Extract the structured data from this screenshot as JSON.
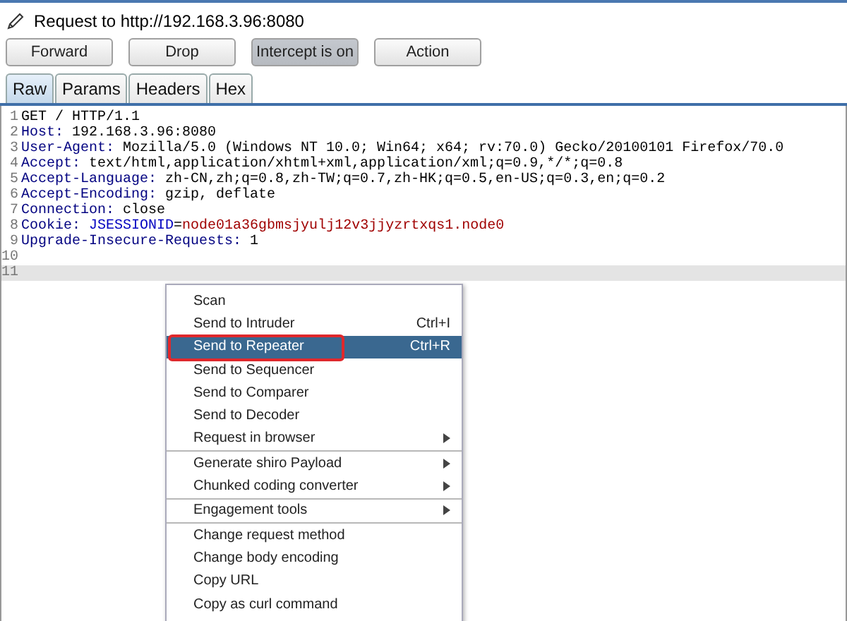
{
  "header": {
    "title": "Request to http://192.168.3.96:8080"
  },
  "buttons": [
    {
      "label": "Forward",
      "pressed": false
    },
    {
      "label": "Drop",
      "pressed": false
    },
    {
      "label": "Intercept is on",
      "pressed": true
    },
    {
      "label": "Action",
      "pressed": false
    }
  ],
  "tabs": [
    {
      "label": "Raw",
      "selected": true
    },
    {
      "label": "Params",
      "selected": false
    },
    {
      "label": "Headers",
      "selected": false
    },
    {
      "label": "Hex",
      "selected": false
    }
  ],
  "editor": {
    "lines": [
      {
        "number": "1",
        "current": false,
        "parts": [
          {
            "text": "GET / HTTP/1.1",
            "kind": "plain"
          }
        ]
      },
      {
        "number": "2",
        "current": false,
        "parts": [
          {
            "text": "Host:",
            "kind": "header"
          },
          {
            "text": " 192.168.3.96:8080",
            "kind": "plain"
          }
        ]
      },
      {
        "number": "3",
        "current": false,
        "parts": [
          {
            "text": "User-Agent:",
            "kind": "header"
          },
          {
            "text": " Mozilla/5.0 (Windows NT 10.0; Win64; x64; rv:70.0) Gecko/20100101 Firefox/70.0",
            "kind": "plain"
          }
        ]
      },
      {
        "number": "4",
        "current": false,
        "parts": [
          {
            "text": "Accept:",
            "kind": "header"
          },
          {
            "text": " text/html,application/xhtml+xml,application/xml;q=0.9,*/*;q=0.8",
            "kind": "plain"
          }
        ]
      },
      {
        "number": "5",
        "current": false,
        "parts": [
          {
            "text": "Accept-Language:",
            "kind": "header"
          },
          {
            "text": " zh-CN,zh;q=0.8,zh-TW;q=0.7,zh-HK;q=0.5,en-US;q=0.3,en;q=0.2",
            "kind": "plain"
          }
        ]
      },
      {
        "number": "6",
        "current": false,
        "parts": [
          {
            "text": "Accept-Encoding:",
            "kind": "header"
          },
          {
            "text": " gzip, deflate",
            "kind": "plain"
          }
        ]
      },
      {
        "number": "7",
        "current": false,
        "parts": [
          {
            "text": "Connection:",
            "kind": "header"
          },
          {
            "text": " close",
            "kind": "plain"
          }
        ]
      },
      {
        "number": "8",
        "current": false,
        "parts": [
          {
            "text": "Cookie:",
            "kind": "header"
          },
          {
            "text": " JSESSIONID",
            "kind": "param_name"
          },
          {
            "text": "=",
            "kind": "plain"
          },
          {
            "text": "node01a36gbmsjyulj12v3jjyzrtxqs1.node0",
            "kind": "param_value"
          }
        ]
      },
      {
        "number": "9",
        "current": false,
        "parts": [
          {
            "text": "Upgrade-Insecure-Requests:",
            "kind": "header"
          },
          {
            "text": " 1",
            "kind": "plain"
          }
        ]
      },
      {
        "number": "10",
        "current": false
      },
      {
        "number": "11",
        "current": true
      }
    ]
  },
  "context_menu": {
    "items": [
      {
        "label": "Scan",
        "selected": false,
        "submenu": false,
        "separator_before": false,
        "highlighted": false
      },
      {
        "label": "Send to Intruder",
        "shortcut": "Ctrl+I",
        "selected": false,
        "submenu": false,
        "separator_before": false,
        "highlighted": false
      },
      {
        "label": "Send to Repeater",
        "shortcut": "Ctrl+R",
        "selected": true,
        "submenu": false,
        "separator_before": false,
        "highlighted": true
      },
      {
        "label": "Send to Sequencer",
        "selected": false,
        "submenu": false,
        "separator_before": false,
        "highlighted": false
      },
      {
        "label": "Send to Comparer",
        "selected": false,
        "submenu": false,
        "separator_before": false,
        "highlighted": false
      },
      {
        "label": "Send to Decoder",
        "selected": false,
        "submenu": false,
        "separator_before": false,
        "highlighted": false
      },
      {
        "label": "Request in browser",
        "selected": false,
        "submenu": true,
        "separator_before": false,
        "highlighted": false
      },
      {
        "label": "Generate shiro Payload",
        "selected": false,
        "submenu": true,
        "separator_before": true,
        "highlighted": false
      },
      {
        "label": "Chunked coding converter",
        "selected": false,
        "submenu": true,
        "separator_before": false,
        "highlighted": false
      },
      {
        "label": "Engagement tools",
        "selected": false,
        "submenu": true,
        "separator_before": true,
        "highlighted": false
      },
      {
        "label": "Change request method",
        "selected": false,
        "submenu": false,
        "separator_before": true,
        "highlighted": false
      },
      {
        "label": "Change body encoding",
        "selected": false,
        "submenu": false,
        "separator_before": false,
        "highlighted": false
      },
      {
        "label": "Copy URL",
        "selected": false,
        "submenu": false,
        "separator_before": false,
        "highlighted": false
      },
      {
        "label": "Copy as curl command",
        "selected": false,
        "submenu": false,
        "separator_before": false,
        "highlighted": false
      }
    ]
  }
}
